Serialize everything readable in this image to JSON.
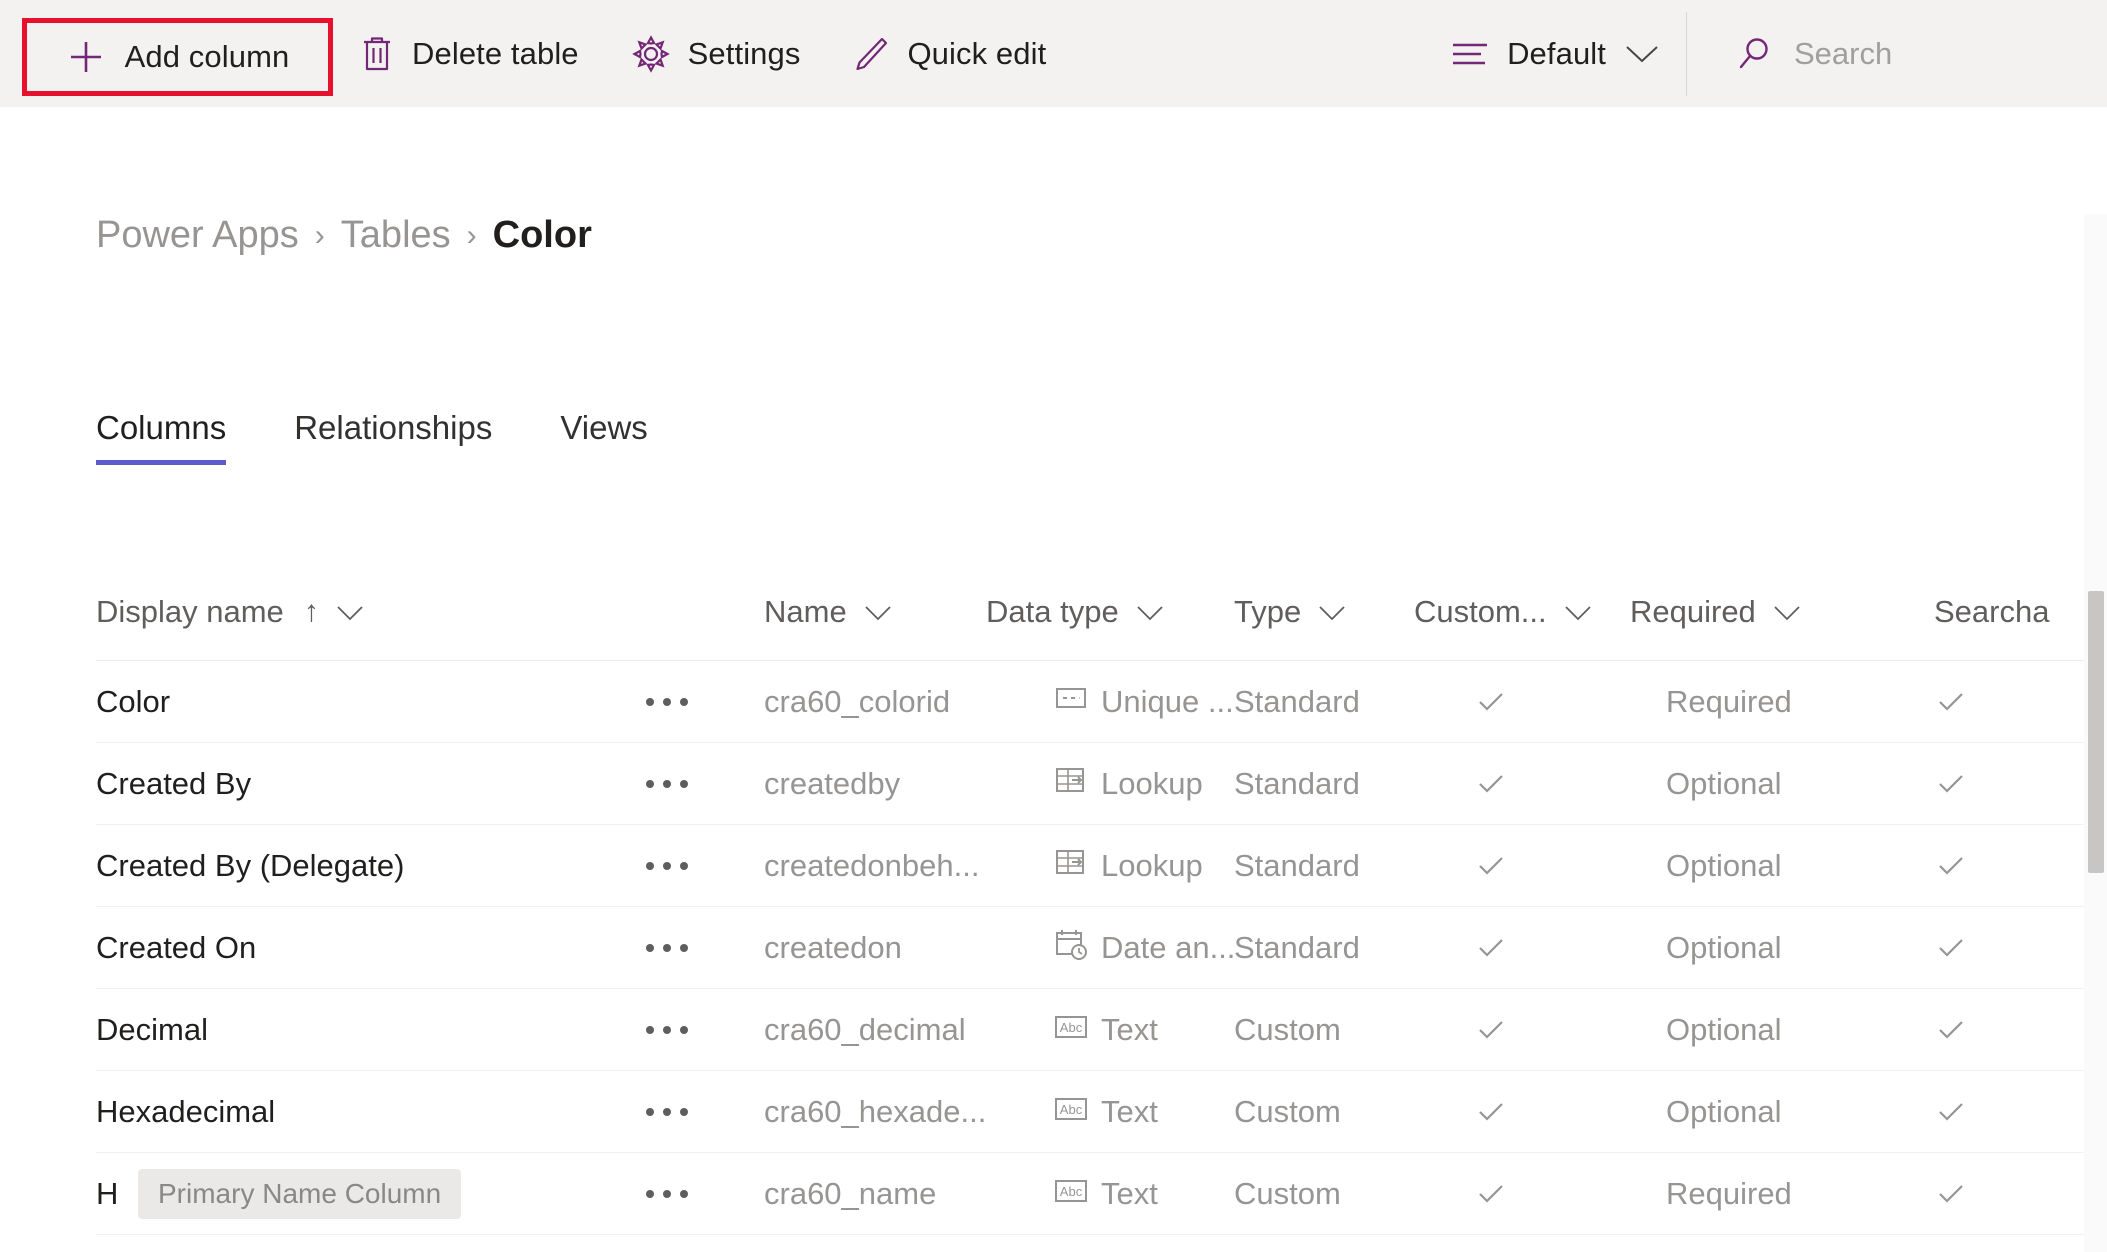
{
  "toolbar": {
    "add_column": {
      "label": "Add column",
      "icon": "plus-icon"
    },
    "delete_table": {
      "label": "Delete table",
      "icon": "trash-icon"
    },
    "settings": {
      "label": "Settings",
      "icon": "gear-icon"
    },
    "quick_edit": {
      "label": "Quick edit",
      "icon": "pencil-icon"
    },
    "view_selector": {
      "label": "Default",
      "icon": "view-list-icon",
      "chevron": "chevron-down-icon"
    },
    "search": {
      "placeholder": "Search",
      "icon": "search-icon"
    },
    "highlight_color": "#e8112d",
    "accent_color": "#742774",
    "background_color": "#f3f2f1"
  },
  "breadcrumb": {
    "separator": "›",
    "items": [
      {
        "label": "Power Apps",
        "current": false
      },
      {
        "label": "Tables",
        "current": false
      },
      {
        "label": "Color",
        "current": true
      }
    ]
  },
  "tabs": {
    "active_index": 0,
    "underline_color": "#5c5ccc",
    "items": [
      {
        "label": "Columns"
      },
      {
        "label": "Relationships"
      },
      {
        "label": "Views"
      }
    ]
  },
  "grid": {
    "sort_indicator": "↑",
    "chevron": "∨",
    "headers": [
      {
        "label": "Display name",
        "sorted": true
      },
      {
        "label": "Name",
        "sorted": false
      },
      {
        "label": "Data type",
        "sorted": false
      },
      {
        "label": "Type",
        "sorted": false
      },
      {
        "label": "Custom...",
        "sorted": false
      },
      {
        "label": "Required",
        "sorted": false
      },
      {
        "label": "Searcha",
        "sorted": false,
        "truncated": true
      }
    ],
    "badge_label": "Primary Name Column",
    "rows": [
      {
        "display_name": "Color",
        "name": "cra60_colorid",
        "data_type": "Unique ...",
        "data_type_icon": "unique-identifier-icon",
        "type": "Standard",
        "customizable": true,
        "required": "Required",
        "searchable": true
      },
      {
        "display_name": "Created By",
        "name": "createdby",
        "data_type": "Lookup",
        "data_type_icon": "lookup-icon",
        "type": "Standard",
        "customizable": true,
        "required": "Optional",
        "searchable": true
      },
      {
        "display_name": "Created By (Delegate)",
        "name": "createdonbeh...",
        "data_type": "Lookup",
        "data_type_icon": "lookup-icon",
        "type": "Standard",
        "customizable": true,
        "required": "Optional",
        "searchable": true
      },
      {
        "display_name": "Created On",
        "name": "createdon",
        "data_type": "Date an...",
        "data_type_icon": "date-time-icon",
        "type": "Standard",
        "customizable": true,
        "required": "Optional",
        "searchable": true
      },
      {
        "display_name": "Decimal",
        "name": "cra60_decimal",
        "data_type": "Text",
        "data_type_icon": "text-abc-icon",
        "type": "Custom",
        "customizable": true,
        "required": "Optional",
        "searchable": true
      },
      {
        "display_name": "Hexadecimal",
        "name": "cra60_hexade...",
        "data_type": "Text",
        "data_type_icon": "text-abc-icon",
        "type": "Custom",
        "customizable": true,
        "required": "Optional",
        "searchable": true
      },
      {
        "display_name": "H",
        "name": "cra60_name",
        "data_type": "Text",
        "data_type_icon": "text-abc-icon",
        "type": "Custom",
        "customizable": true,
        "required": "Required",
        "searchable": true,
        "has_badge": true
      }
    ]
  }
}
